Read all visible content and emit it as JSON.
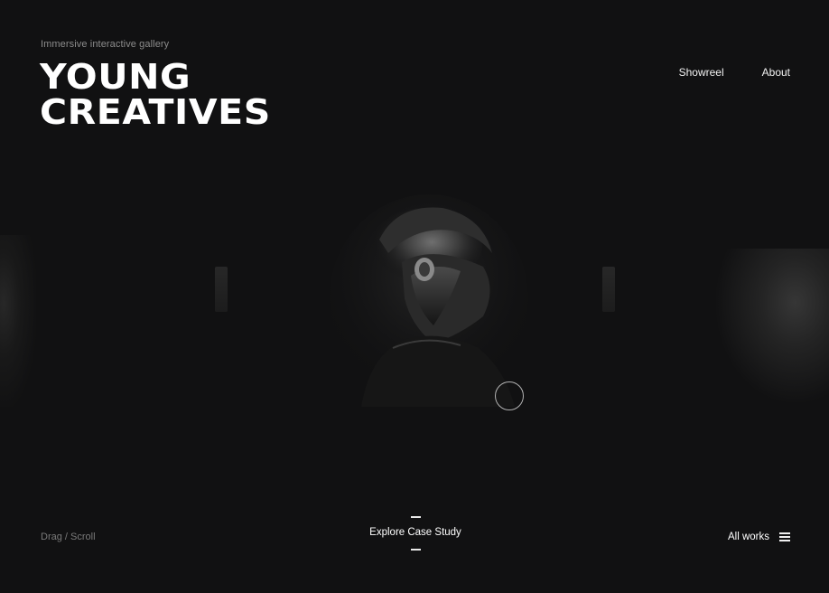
{
  "header": {
    "tagline": "Immersive interactive gallery",
    "title_line1": "YOUNG",
    "title_line2": "CREATIVES"
  },
  "nav": {
    "items": [
      {
        "label": "Showreel"
      },
      {
        "label": "About"
      }
    ]
  },
  "footer": {
    "hint": "Drag / Scroll",
    "cta_label": "Explore Case Study",
    "all_works_label": "All works"
  },
  "icons": {
    "menu": "hamburger-menu-icon",
    "cursor": "cursor-ring-icon"
  },
  "colors": {
    "background": "#111112",
    "text": "#ffffff",
    "muted": "#8c8c8c"
  }
}
